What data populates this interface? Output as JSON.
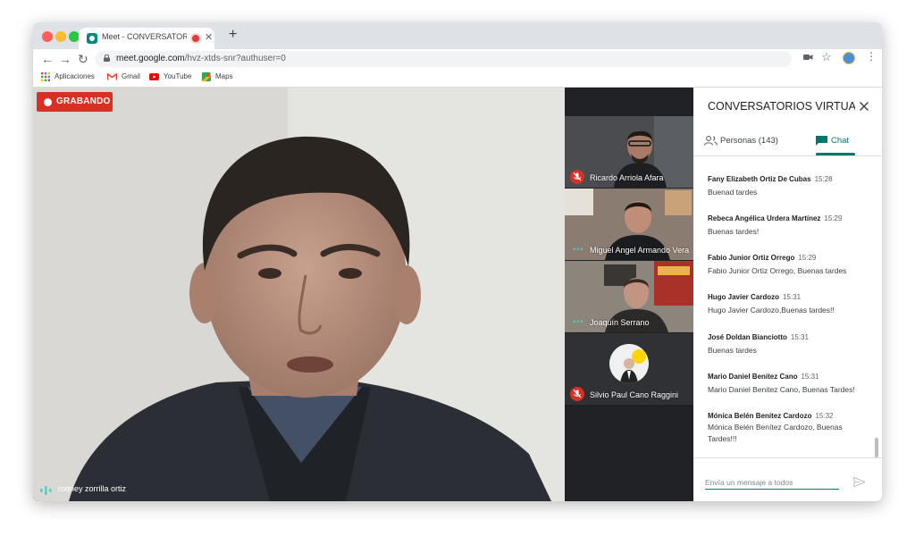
{
  "browser": {
    "tab_title": "Meet - CONVERSATORIOS VIRTUALES",
    "new_tab_symbol": "+",
    "url_host": "meet.google.com",
    "url_path": "/hvz-xtds-snr?authuser=0",
    "bookmarks": [
      {
        "label": "Aplicaciones",
        "icon": "apps-grid-icon"
      },
      {
        "label": "Gmail",
        "icon": "gmail-icon"
      },
      {
        "label": "YouTube",
        "icon": "youtube-icon"
      },
      {
        "label": "Maps",
        "icon": "maps-icon"
      }
    ]
  },
  "meeting": {
    "recording_label": "GRABANDO",
    "main_speaker": "rodney zorrilla ortiz",
    "participants": [
      {
        "name": "Ricardo Arriola Afara",
        "status": "muted"
      },
      {
        "name": "Miguel Angel Armando Vera",
        "status": "speaking"
      },
      {
        "name": "Joaquín Serrano",
        "status": "speaking"
      },
      {
        "name": "Silvio Paul Cano Raggini",
        "status": "muted"
      }
    ]
  },
  "panel": {
    "title": "CONVERSATORIOS VIRTUAL...",
    "people_tab": "Personas (143)",
    "chat_tab": "Chat",
    "messages": [
      {
        "sender": "Fany Elizabeth Ortiz De Cubas",
        "time": "15:28",
        "text": "Buenad tardes"
      },
      {
        "sender": "Rebeca Angélica Urdera Martínez",
        "time": "15:29",
        "text": "Buenas tardes!"
      },
      {
        "sender": "Fabio Junior Ortiz Orrego",
        "time": "15:29",
        "text": "Fabio Junior Ortiz Orrego, Buenas tardes"
      },
      {
        "sender": "Hugo Javier Cardozo",
        "time": "15:31",
        "text": "Hugo Javier Cardozo,Buenas tardes!!"
      },
      {
        "sender": "José Doldan Bianciotto",
        "time": "15:31",
        "text": "Buenas tardes"
      },
      {
        "sender": "Mario Daniel Benitez Cano",
        "time": "15:31",
        "text": "Mario Daniel Benitez Cano, Buenas Tardes!"
      },
      {
        "sender": "Mónica Belén Benítez Cardozo",
        "time": "15:32",
        "text": "Mónica Belén Benítez Cardozo, Buenas Tardes!!!"
      }
    ],
    "input_placeholder": "Envía un mensaje a todos"
  },
  "colors": {
    "accent": "#00796b",
    "record_red": "#d93025"
  }
}
